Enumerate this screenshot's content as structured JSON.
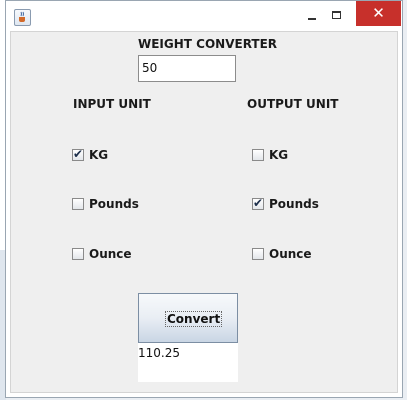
{
  "window": {
    "close_glyph": "✕",
    "icon": "java-cup-icon"
  },
  "form": {
    "title": "WEIGHT CONVERTER",
    "input_value": "50",
    "input_unit_label": "INPUT UNIT",
    "output_unit_label": "OUTPUT UNIT",
    "input_options": [
      {
        "label": "KG",
        "checked": true
      },
      {
        "label": "Pounds",
        "checked": false
      },
      {
        "label": "Ounce",
        "checked": false
      }
    ],
    "output_options": [
      {
        "label": "KG",
        "checked": false
      },
      {
        "label": "Pounds",
        "checked": true
      },
      {
        "label": "Ounce",
        "checked": false
      }
    ],
    "convert_label": "Convert",
    "result": "110.25"
  },
  "colors": {
    "close_button": "#c7302b",
    "panel_background": "#efefef"
  }
}
